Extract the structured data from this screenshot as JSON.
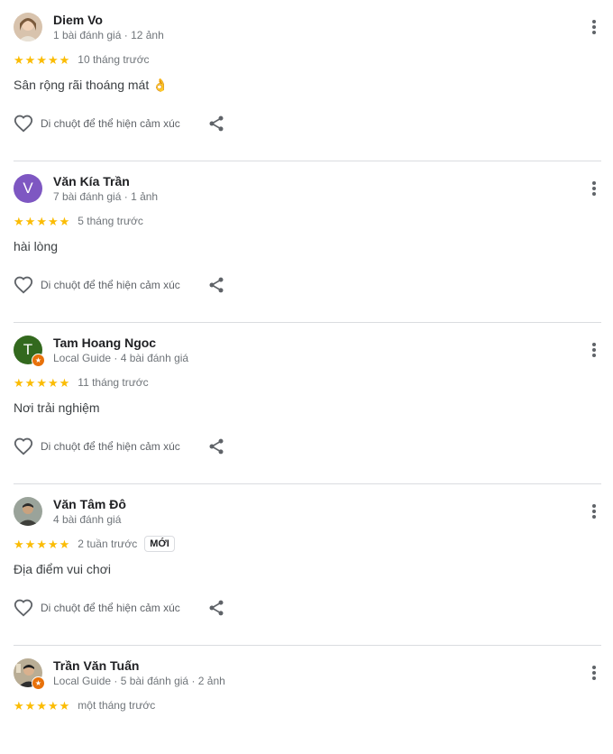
{
  "reviews": [
    {
      "name": "Diem Vo",
      "meta": "1 bài đánh giá · 12 ảnh",
      "avatar_type": "photo",
      "avatar_color": "#c9a88a",
      "stars": 5,
      "time": "10 tháng trước",
      "text": "Sân rộng rãi thoáng mát 👌",
      "reaction_label": "Di chuột để thể hiện cảm xúc"
    },
    {
      "name": "Văn Kía Trần",
      "meta": "7 bài đánh giá · 1 ảnh",
      "avatar_type": "letter",
      "avatar_letter": "V",
      "avatar_color": "#7e57c2",
      "stars": 5,
      "time": "5 tháng trước",
      "text": "hài lòng",
      "reaction_label": "Di chuột để thể hiện cảm xúc"
    },
    {
      "name": "Tam Hoang Ngoc",
      "meta": "Local Guide · 4 bài đánh giá",
      "avatar_type": "letter",
      "avatar_letter": "T",
      "avatar_color": "#33691e",
      "local_guide": true,
      "stars": 5,
      "time": "11 tháng trước",
      "text": "Nơi trải nghiệm",
      "reaction_label": "Di chuột để thể hiện cảm xúc"
    },
    {
      "name": "Văn Tâm Đô",
      "meta": "4 bài đánh giá",
      "avatar_type": "photo",
      "avatar_color": "#6d6a5c",
      "stars": 5,
      "time": "2 tuần trước",
      "new_badge": "MỚI",
      "text": "Địa điểm vui chơi",
      "reaction_label": "Di chuột để thể hiện cảm xúc"
    },
    {
      "name": "Trần Văn Tuấn",
      "meta": "Local Guide · 5 bài đánh giá · 2 ảnh",
      "avatar_type": "photo",
      "avatar_color": "#8a7a62",
      "local_guide": true,
      "stars": 5,
      "time": "một tháng trước"
    }
  ],
  "icons": {
    "star": "star-icon",
    "more": "more-vert-icon",
    "heart": "heart-outline-icon",
    "share": "share-icon"
  },
  "colors": {
    "star": "#fbbc04",
    "local_guide_badge": "#e8710a",
    "divider": "#dadce0"
  }
}
